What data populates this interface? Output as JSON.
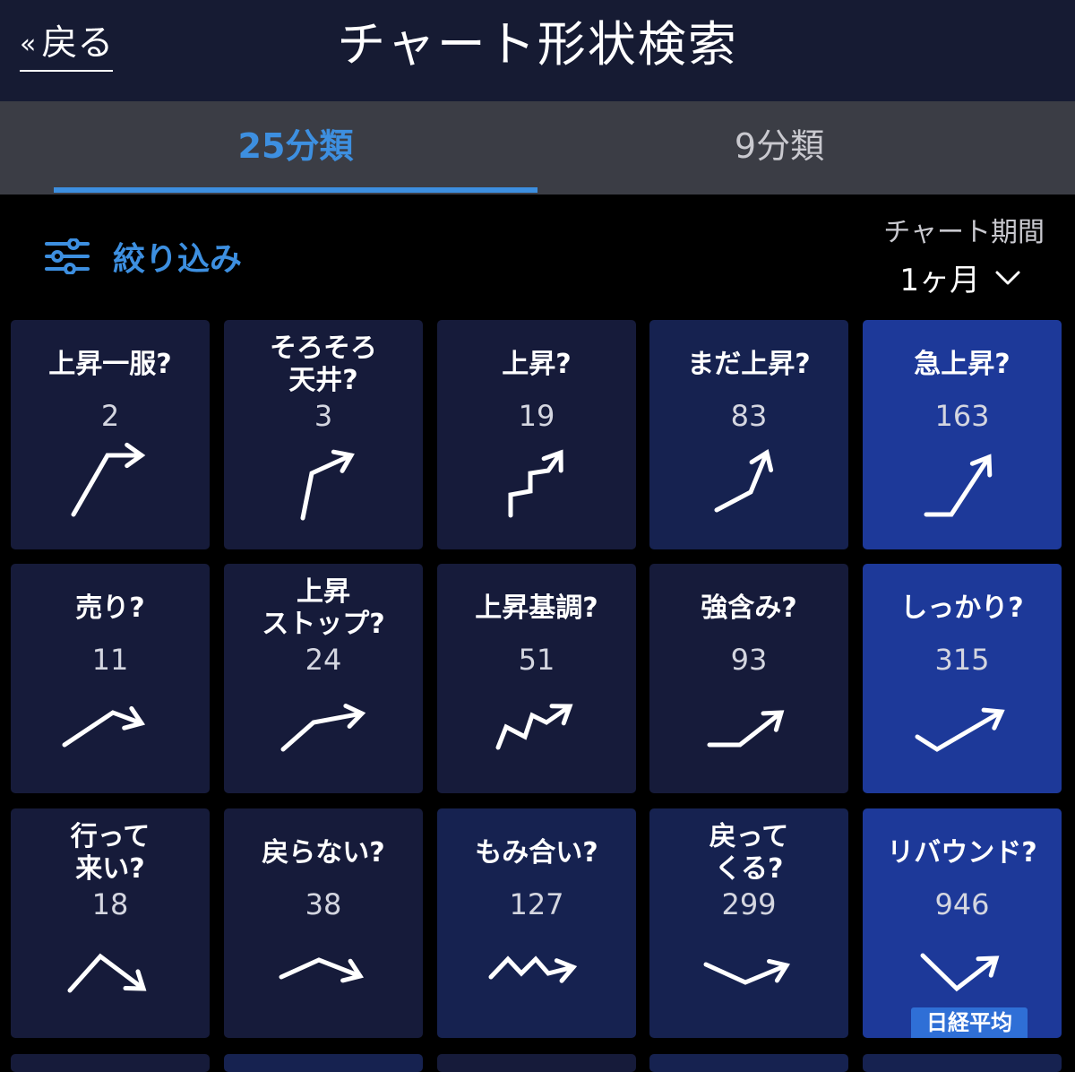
{
  "header": {
    "back_label": "戻る",
    "back_chevron": "«",
    "title": "チャート形状検索"
  },
  "tabs": [
    {
      "label": "25分類",
      "active": true
    },
    {
      "label": "9分類",
      "active": false
    }
  ],
  "filter": {
    "label": "絞り込み",
    "icon": "sliders-icon"
  },
  "period": {
    "label": "チャート期間",
    "value": "1ヶ月",
    "icon": "chevron-down-icon"
  },
  "colors": {
    "accent": "#3d8fe0",
    "header_bg": "#161b33",
    "tabbar_bg": "#3b3d45",
    "card_level_1": "#161b3a",
    "card_level_2": "#162250",
    "card_level_3": "#1d3999"
  },
  "cards": [
    {
      "label": "上昇一服?",
      "count": "2",
      "shape": "rise-then-flat-arrow"
    },
    {
      "label": "そろそろ\n天井?",
      "count": "3",
      "shape": "rise-peaking-arrow"
    },
    {
      "label": "上昇?",
      "count": "19",
      "shape": "step-up-arrow"
    },
    {
      "label": "まだ上昇?",
      "count": "83",
      "shape": "continued-rise-arrow"
    },
    {
      "label": "急上昇?",
      "count": "163",
      "shape": "sharp-rise-arrow"
    },
    {
      "label": "売り?",
      "count": "11",
      "shape": "up-then-dip-arrow"
    },
    {
      "label": "上昇\nストップ?",
      "count": "24",
      "shape": "rise-stop-arrow"
    },
    {
      "label": "上昇基調?",
      "count": "51",
      "shape": "zigzag-up-arrow"
    },
    {
      "label": "強含み?",
      "count": "93",
      "shape": "flat-then-up-arrow"
    },
    {
      "label": "しっかり?",
      "count": "315",
      "shape": "dip-then-up-arrow"
    },
    {
      "label": "行って\n来い?",
      "count": "18",
      "shape": "peak-then-down-arrow"
    },
    {
      "label": "戻らない?",
      "count": "38",
      "shape": "rise-then-down-arrow"
    },
    {
      "label": "もみ合い?",
      "count": "127",
      "shape": "sideways-zigzag-arrow"
    },
    {
      "label": "戻って\nくる?",
      "count": "299",
      "shape": "down-then-up-arrow"
    },
    {
      "label": "リバウンド?",
      "count": "946",
      "shape": "v-rebound-arrow",
      "badge": "日経平均"
    }
  ]
}
